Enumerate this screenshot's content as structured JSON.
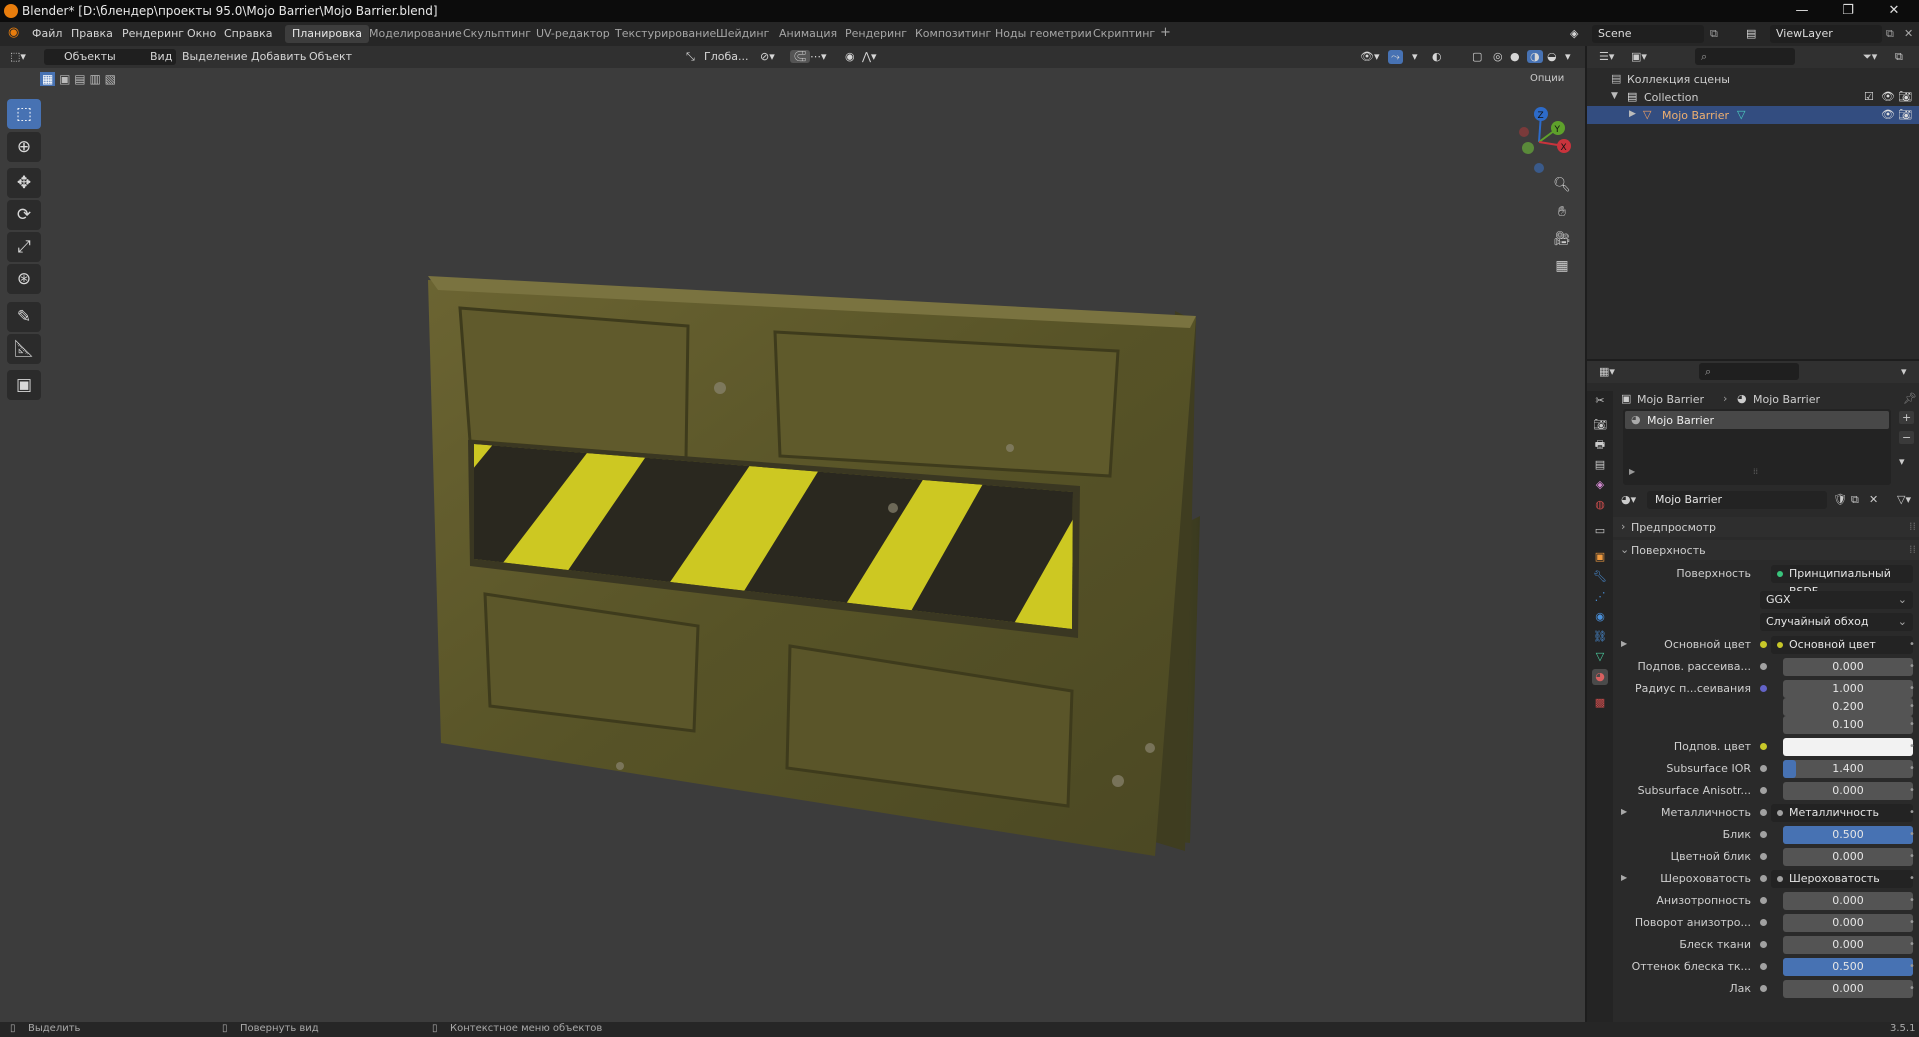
{
  "window": {
    "title": "Blender* [D:\\блендер\\проекты 95.0\\Mojo Barrier\\Mojo Barrier.blend]"
  },
  "menus": [
    "Файл",
    "Правка",
    "Рендеринг",
    "Окно",
    "Справка"
  ],
  "workspaces": [
    "Планировка",
    "Моделирование",
    "Скульптинг",
    "UV-редактор",
    "Текстурирование",
    "Шейдинг",
    "Анимация",
    "Рендеринг",
    "Композитинг",
    "Ноды геометрии",
    "Скриптинг"
  ],
  "active_workspace": "Планировка",
  "scene": "Scene",
  "view_layer": "ViewLayer",
  "viewport_header": {
    "mode": "Объекты",
    "menus": [
      "Вид",
      "Выделение",
      "Добавить",
      "Объект"
    ],
    "orientation": "Глоба...",
    "options_label": "Опции"
  },
  "toolbar_icons": [
    "select-box-icon",
    "cursor-icon",
    "move-icon",
    "rotate-icon",
    "scale-icon",
    "transform-icon",
    "annotate-icon",
    "measure-icon",
    "add-cube-icon"
  ],
  "gizmo": {
    "z": "Z",
    "y": "Y",
    "x": "X"
  },
  "outliner": {
    "scene_collection": "Коллекция сцены",
    "collection": "Collection",
    "object": "Mojo Barrier"
  },
  "properties": {
    "breadcrumb_object": "Mojo Barrier",
    "breadcrumb_material": "Mojo Barrier",
    "slot_name": "Mojo Barrier",
    "material_name": "Mojo Barrier",
    "panel_preview": "Предпросмотр",
    "panel_surface": "Поверхность",
    "surface_label": "Поверхность",
    "surface_value": "Принципиальный BSDF",
    "distribution": "GGX",
    "subsurface_method": "Случайный обход",
    "rows": [
      {
        "label": "Основной цвет",
        "link": "Основной цвет",
        "dot": "#c7c729"
      },
      {
        "label": "Подпов. рассеива...",
        "value": "0.000",
        "fill": 0,
        "dot": "#a1a1a1"
      },
      {
        "label": "Радиус п...сеивания",
        "value": "1.000",
        "fill": 0,
        "dot": "#6363c7"
      },
      {
        "label": "",
        "value": "0.200",
        "fill": 0
      },
      {
        "label": "",
        "value": "0.100",
        "fill": 0
      },
      {
        "label": "Подпов. цвет",
        "color": "#f2f2f2",
        "dot": "#c7c729"
      },
      {
        "label": "Subsurface IOR",
        "value": "1.400",
        "fill": 0.1,
        "dot": "#a1a1a1"
      },
      {
        "label": "Subsurface Anisotr...",
        "value": "0.000",
        "fill": 0,
        "dot": "#a1a1a1"
      },
      {
        "label": "Металличность",
        "link": "Металличность",
        "dot": "#a1a1a1"
      },
      {
        "label": "Блик",
        "value": "0.500",
        "fill": 1,
        "dot": "#a1a1a1"
      },
      {
        "label": "Цветной блик",
        "value": "0.000",
        "fill": 0,
        "dot": "#a1a1a1"
      },
      {
        "label": "Шероховатость",
        "link": "Шероховатость",
        "dot": "#a1a1a1"
      },
      {
        "label": "Анизотропность",
        "value": "0.000",
        "fill": 0,
        "dot": "#a1a1a1"
      },
      {
        "label": "Поворот анизотро...",
        "value": "0.000",
        "fill": 0,
        "dot": "#a1a1a1"
      },
      {
        "label": "Блеск ткани",
        "value": "0.000",
        "fill": 0,
        "dot": "#a1a1a1"
      },
      {
        "label": "Оттенок блеска тк...",
        "value": "0.500",
        "fill": 1,
        "dot": "#a1a1a1"
      },
      {
        "label": "Лак",
        "value": "0.000",
        "fill": 0,
        "dot": "#a1a1a1"
      }
    ]
  },
  "status": {
    "select": "Выделить",
    "rotate": "Повернуть вид",
    "context": "Контекстное меню объектов",
    "version": "3.5.1"
  },
  "colors": {
    "accent": "#4772b3",
    "selected_row": "#334d80"
  }
}
